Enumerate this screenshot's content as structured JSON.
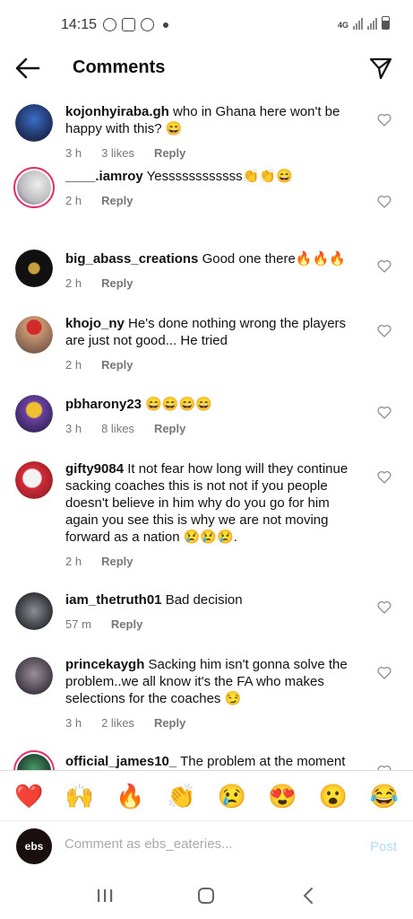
{
  "status_bar": {
    "time": "14:15",
    "network": "4G"
  },
  "header": {
    "title": "Comments"
  },
  "comments": [
    {
      "username": "kojonhyiraba.gh",
      "text": " who in Ghana here won't be happy with this? 😄",
      "time": "3 h",
      "likes": "3 likes",
      "reply": "Reply",
      "avatar_color": "#2b4a8a"
    },
    {
      "username": "____.iamroy",
      "text": " Yessssssssssss👏👏😄",
      "time": "2 h",
      "likes": "",
      "reply": "Reply",
      "avatar_color": "#d9d9d9"
    },
    {
      "username": "big_abass_creations",
      "text": " Good one there🔥🔥🔥",
      "time": "2 h",
      "likes": "",
      "reply": "Reply",
      "avatar_color": "#111111"
    },
    {
      "username": "khojo_ny",
      "text": " He's done nothing wrong the players are just not good... He tried",
      "time": "2 h",
      "likes": "",
      "reply": "Reply",
      "avatar_color": "#b48a6a"
    },
    {
      "username": "pbharony23",
      "text": " 😄😄😄😄",
      "time": "3 h",
      "likes": "8 likes",
      "reply": "Reply",
      "avatar_color": "#3b3472"
    },
    {
      "username": "gifty9084",
      "text": " It not fear how long will they continue sacking coaches this is not not if you people doesn't believe in him why do you go for him again you see this is why we are not moving forward as a nation 😢😢😢.",
      "time": "2 h",
      "likes": "",
      "reply": "Reply",
      "avatar_color": "#c0303a"
    },
    {
      "username": "iam_thetruth01",
      "text": " Bad decision",
      "time": "57 m",
      "likes": "",
      "reply": "Reply",
      "avatar_color": "#4a4d52"
    },
    {
      "username": "princekaygh",
      "text": " Sacking him isn't gonna solve the problem..we all know it's the FA who makes selections for the coaches 😏",
      "time": "3 h",
      "likes": "2 likes",
      "reply": "Reply",
      "avatar_color": "#5d5560"
    },
    {
      "username": "official_james10_",
      "text": " The problem at the moment",
      "time": "",
      "likes": "",
      "reply": "",
      "avatar_color": "#2d6b4a"
    }
  ],
  "emoji_bar": [
    "❤️",
    "🙌",
    "🔥",
    "👏",
    "😢",
    "😍",
    "😮",
    "😂"
  ],
  "comment_box": {
    "avatar_label": "ebs",
    "placeholder": "Comment as ebs_eateries...",
    "post_label": "Post"
  },
  "colors": {
    "link_blue": "#b3dbff",
    "ring": "#e1306c"
  }
}
